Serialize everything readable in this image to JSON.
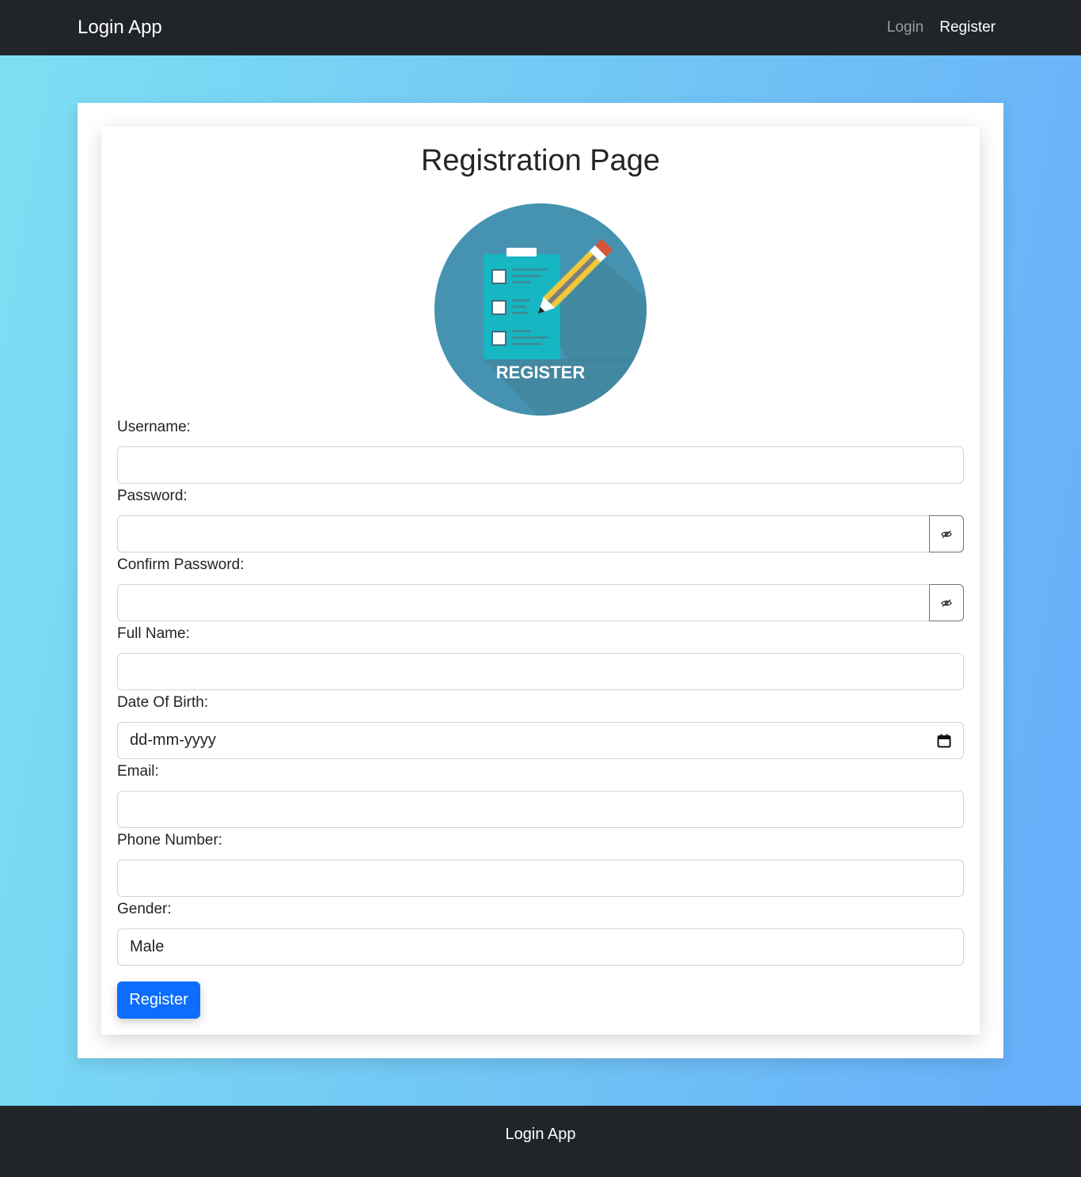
{
  "navbar": {
    "brand": "Login App",
    "links": [
      {
        "label": "Login",
        "active": false
      },
      {
        "label": "Register",
        "active": true
      }
    ]
  },
  "form": {
    "title": "Registration Page",
    "logo_caption": "REGISTER",
    "fields": {
      "username": {
        "label": "Username:",
        "value": ""
      },
      "password": {
        "label": "Password:",
        "value": "",
        "toggle_icon": "eye-slash-icon"
      },
      "confirm_password": {
        "label": "Confirm Password:",
        "value": "",
        "toggle_icon": "eye-slash-icon"
      },
      "full_name": {
        "label": "Full Name:",
        "value": ""
      },
      "dob": {
        "label": "Date Of Birth:",
        "placeholder": "dd-mm-yyyy",
        "icon": "calendar-icon"
      },
      "email": {
        "label": "Email:",
        "value": ""
      },
      "phone": {
        "label": "Phone Number:",
        "value": ""
      },
      "gender": {
        "label": "Gender:",
        "selected": "Male"
      }
    },
    "submit_label": "Register"
  },
  "footer": {
    "text": "Login App"
  },
  "colors": {
    "navbar_bg": "#212529",
    "primary": "#0d6efd",
    "logo_circle": "#4593b0",
    "clipboard": "#16b6c2",
    "pencil_yellow": "#f1c93a",
    "pencil_tip": "#d6553a"
  }
}
